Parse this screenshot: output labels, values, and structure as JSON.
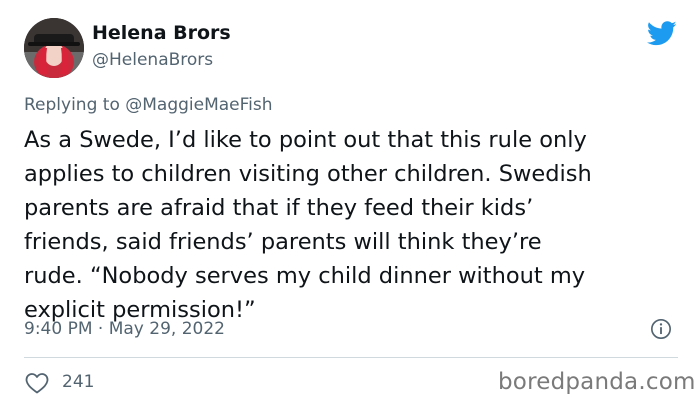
{
  "author": {
    "name": "Helena Brors",
    "handle": "@HelenaBrors"
  },
  "reply": {
    "prefix": "Replying to",
    "mention": "@MaggieMaeFish"
  },
  "body_lines": [
    "As a Swede, I’d like to point out that this rule only",
    "applies to children visiting other children. Swedish",
    "parents are afraid that if they feed their kids’",
    "friends, said friends’ parents will think they’re",
    "rude. “Nobody serves my child dinner without my",
    "explicit permission!”"
  ],
  "meta": {
    "time": "9:40 PM",
    "separator": "·",
    "date": "May 29, 2022"
  },
  "actions": {
    "like_count": "241"
  },
  "watermark": "boredpanda.com",
  "icons": {
    "brand": "twitter-bird-icon",
    "info": "info-icon",
    "like": "heart-icon"
  },
  "colors": {
    "brand": "#1d9bf0",
    "text": "#0f1419",
    "secondary": "#536471",
    "divider": "#cfd9de"
  }
}
